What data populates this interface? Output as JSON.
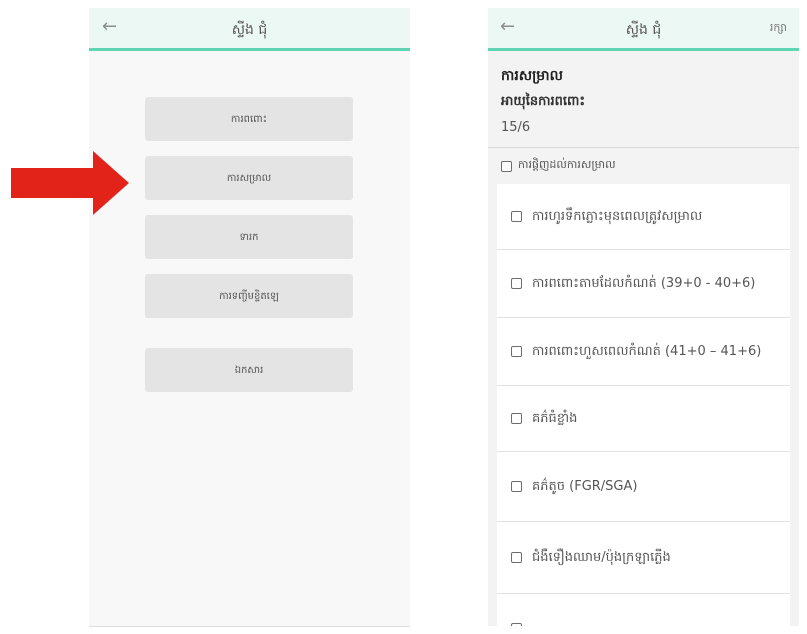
{
  "left_screen": {
    "title": "ស្ទីង ជុំ",
    "back_icon": "arrow-left-icon",
    "menu": [
      {
        "label": "ការពពោះ"
      },
      {
        "label": "ការសម្រាល"
      },
      {
        "label": "ទារក"
      },
      {
        "label": "ការទញ្ចីមខ្ទិតឡេ"
      },
      {
        "label": "ឯកសារ"
      }
    ]
  },
  "arrow": {
    "icon": "red-arrow-right-icon",
    "color": "#e2231a"
  },
  "right_screen": {
    "title": "ស្ទីង ជុំ",
    "back_icon": "arrow-left-icon",
    "save_label": "រក្សា",
    "section_title": "ការសម្រាល",
    "ga_label": "អាយុនៃការពពោះ",
    "ga_value": "15/6",
    "complete_label": "ការផ្ដិញដល់ការសម្រាល",
    "options": [
      {
        "label": "ការហូរទឹកភ្លោះមុនពេលត្រូវសម្រាល"
      },
      {
        "label": "ការពពោះតាមដែលកំណត់ (39+0 - 40+6)"
      },
      {
        "label": "ការពពោះហួសពេលកំណត់ (41+0 – 41+6)"
      },
      {
        "label": "គភ៌ធំខ្លាំង"
      },
      {
        "label": "គភ៌តូច (FGR/SGA)"
      },
      {
        "label": "ជំងឺទឿងឈាម/ប៉ុងក្រឡាភ្លើង"
      }
    ]
  },
  "colors": {
    "accent": "#5fd4b3",
    "topbar": "#ecf8f3",
    "arrow": "#e2231a"
  }
}
